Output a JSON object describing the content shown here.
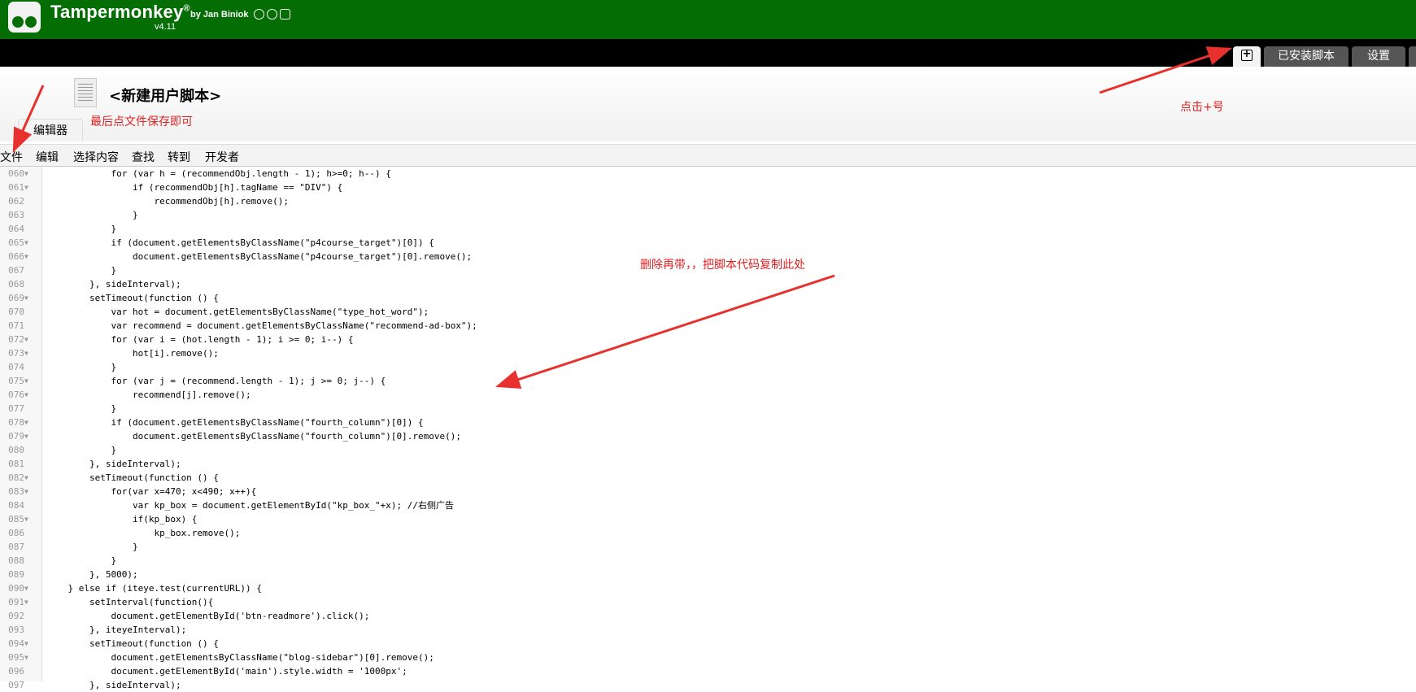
{
  "brand": {
    "name": "Tampermonkey",
    "reg": "®",
    "by": "by Jan Biniok",
    "version": "v4.11"
  },
  "tabs": {
    "add": "+",
    "installed": "已安装脚本",
    "settings": "设置"
  },
  "header": {
    "title": "<新建用户脚本>",
    "editor_tab": "编辑器"
  },
  "menu": [
    "文件",
    "编辑",
    "选择内容",
    "查找",
    "转到",
    "开发者"
  ],
  "annotations": {
    "save_hint": "最后点文件保存即可",
    "add_hint": "点击+号",
    "paste_hint": "删除再带，，把脚本代码复制此处"
  },
  "colors": {
    "brand_green": "#046d04",
    "annotation_red": "#e02020"
  },
  "code_lines": [
    {
      "n": "060",
      "fold": true,
      "text": "            for (var h = (recommendObj.length - 1); h>=0; h--) {"
    },
    {
      "n": "061",
      "fold": true,
      "text": "                if (recommendObj[h].tagName == \"DIV\") {"
    },
    {
      "n": "062",
      "fold": false,
      "text": "                    recommendObj[h].remove();"
    },
    {
      "n": "063",
      "fold": false,
      "text": "                }"
    },
    {
      "n": "064",
      "fold": false,
      "text": "            }"
    },
    {
      "n": "065",
      "fold": true,
      "text": "            if (document.getElementsByClassName(\"p4course_target\")[0]) {"
    },
    {
      "n": "066",
      "fold": true,
      "text": "                document.getElementsByClassName(\"p4course_target\")[0].remove();"
    },
    {
      "n": "067",
      "fold": false,
      "text": "            }"
    },
    {
      "n": "068",
      "fold": false,
      "text": "        }, sideInterval);"
    },
    {
      "n": "069",
      "fold": true,
      "text": "        setTimeout(function () {"
    },
    {
      "n": "070",
      "fold": false,
      "text": "            var hot = document.getElementsByClassName(\"type_hot_word\");"
    },
    {
      "n": "071",
      "fold": false,
      "text": "            var recommend = document.getElementsByClassName(\"recommend-ad-box\");"
    },
    {
      "n": "072",
      "fold": true,
      "text": "            for (var i = (hot.length - 1); i >= 0; i--) {"
    },
    {
      "n": "073",
      "fold": true,
      "text": "                hot[i].remove();"
    },
    {
      "n": "074",
      "fold": false,
      "text": "            }"
    },
    {
      "n": "075",
      "fold": true,
      "text": "            for (var j = (recommend.length - 1); j >= 0; j--) {"
    },
    {
      "n": "076",
      "fold": true,
      "text": "                recommend[j].remove();"
    },
    {
      "n": "077",
      "fold": false,
      "text": "            }"
    },
    {
      "n": "078",
      "fold": true,
      "text": "            if (document.getElementsByClassName(\"fourth_column\")[0]) {"
    },
    {
      "n": "079",
      "fold": true,
      "text": "                document.getElementsByClassName(\"fourth_column\")[0].remove();"
    },
    {
      "n": "080",
      "fold": false,
      "text": "            }"
    },
    {
      "n": "081",
      "fold": false,
      "text": "        }, sideInterval);"
    },
    {
      "n": "082",
      "fold": true,
      "text": "        setTimeout(function () {"
    },
    {
      "n": "083",
      "fold": true,
      "text": "            for(var x=470; x<490; x++){"
    },
    {
      "n": "084",
      "fold": false,
      "text": "                var kp_box = document.getElementById(\"kp_box_\"+x); //右侧广告"
    },
    {
      "n": "085",
      "fold": true,
      "text": "                if(kp_box) {"
    },
    {
      "n": "086",
      "fold": false,
      "text": "                    kp_box.remove();"
    },
    {
      "n": "087",
      "fold": false,
      "text": "                }"
    },
    {
      "n": "088",
      "fold": false,
      "text": "            }"
    },
    {
      "n": "089",
      "fold": false,
      "text": "        }, 5000);"
    },
    {
      "n": "090",
      "fold": true,
      "text": "    } else if (iteye.test(currentURL)) {"
    },
    {
      "n": "091",
      "fold": true,
      "text": "        setInterval(function(){"
    },
    {
      "n": "092",
      "fold": false,
      "text": "            document.getElementById('btn-readmore').click();"
    },
    {
      "n": "093",
      "fold": false,
      "text": "        }, iteyeInterval);"
    },
    {
      "n": "094",
      "fold": true,
      "text": "        setTimeout(function () {"
    },
    {
      "n": "095",
      "fold": true,
      "text": "            document.getElementsByClassName(\"blog-sidebar\")[0].remove();"
    },
    {
      "n": "096",
      "fold": false,
      "text": "            document.getElementById('main').style.width = '1000px';"
    },
    {
      "n": "097",
      "fold": false,
      "text": "        }, sideInterval);"
    }
  ]
}
